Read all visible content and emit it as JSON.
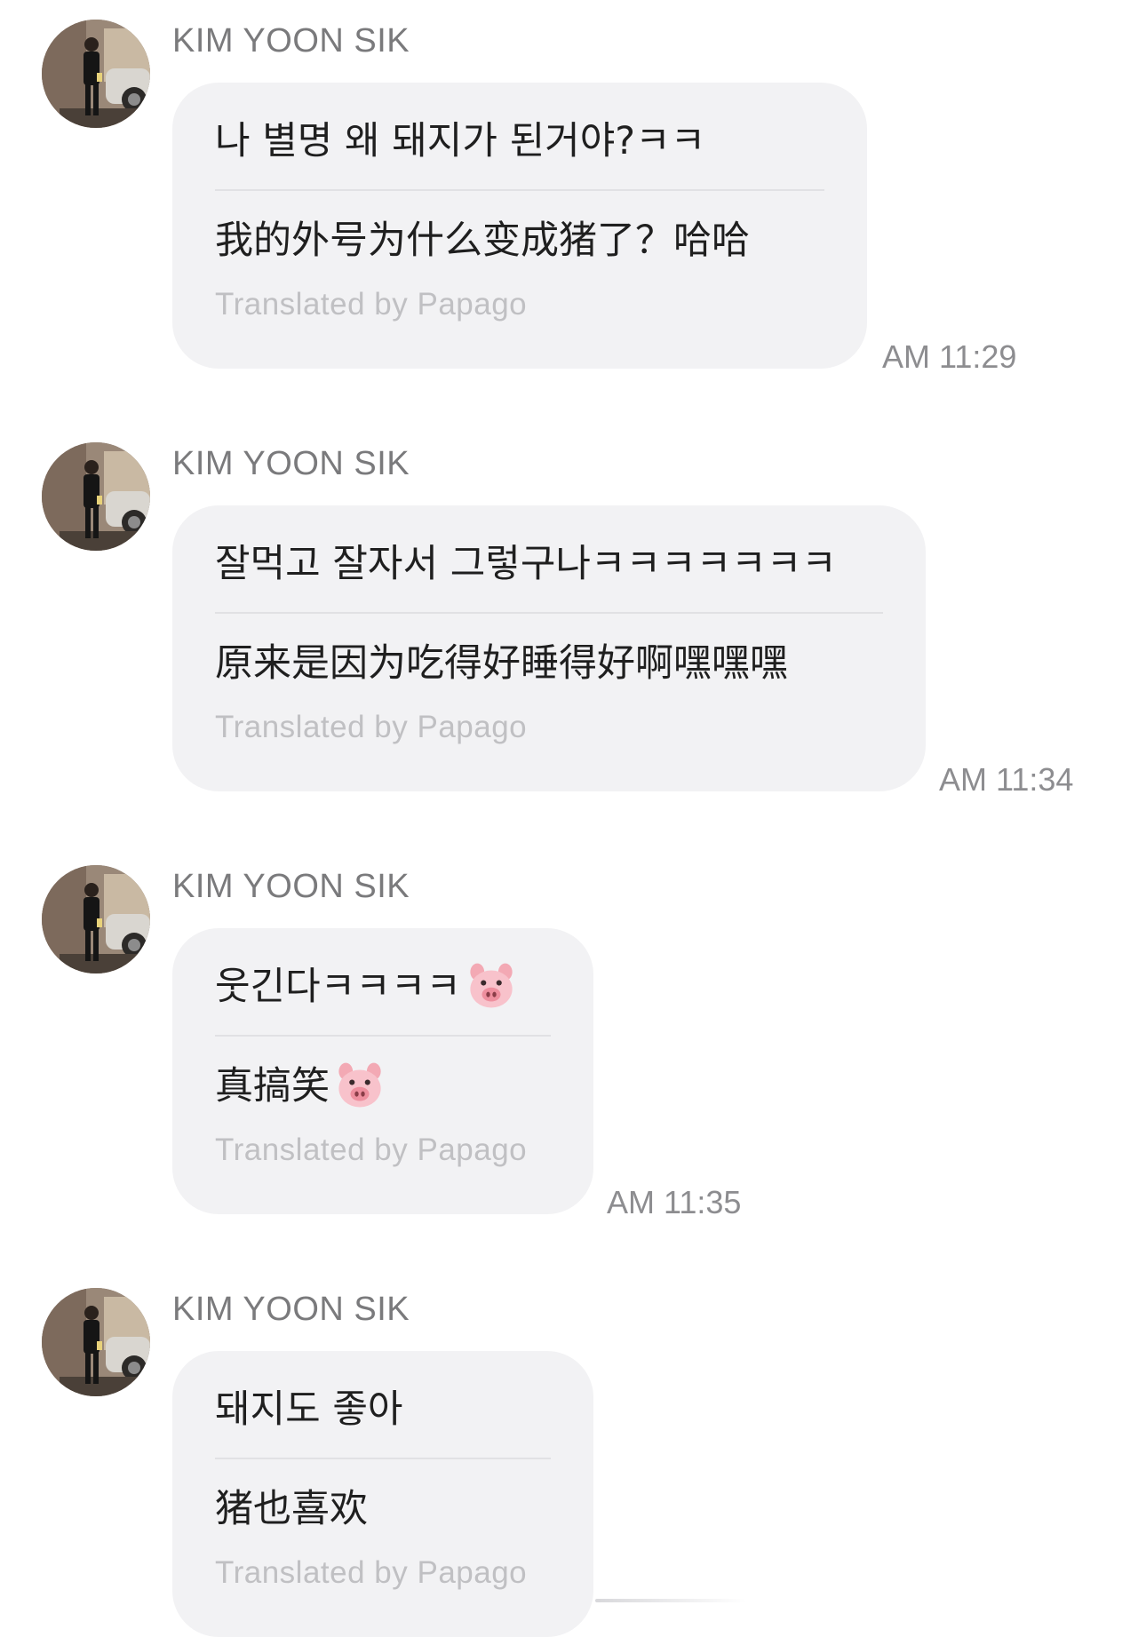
{
  "messages": [
    {
      "sender": "KIM YOON SIK",
      "original": "나 별명 왜 돼지가 된거야?ㅋㅋ",
      "translated": "我的外号为什么变成猪了？哈哈",
      "credit": "Translated by Papago",
      "time": "AM 11:29"
    },
    {
      "sender": "KIM YOON SIK",
      "original": "잘먹고 잘자서 그렇구나ㅋㅋㅋㅋㅋㅋㅋ",
      "translated": "原来是因为吃得好睡得好啊嘿嘿嘿",
      "credit": "Translated by Papago",
      "time": "AM 11:34"
    },
    {
      "sender": "KIM YOON SIK",
      "original": "웃긴다ㅋㅋㅋㅋ",
      "translated": "真搞笑",
      "credit": "Translated by Papago",
      "time": "AM 11:35",
      "emoji": "pig-face"
    },
    {
      "sender": "KIM YOON SIK",
      "original": "돼지도 좋아",
      "translated": "猪也喜欢",
      "credit": "Translated by Papago",
      "time": ""
    }
  ],
  "colors": {
    "bubble": "#f2f2f4",
    "sender": "#7a7a7c",
    "text": "#1f1f1f",
    "credit": "#c0c0c3",
    "time": "#8d8d90"
  }
}
